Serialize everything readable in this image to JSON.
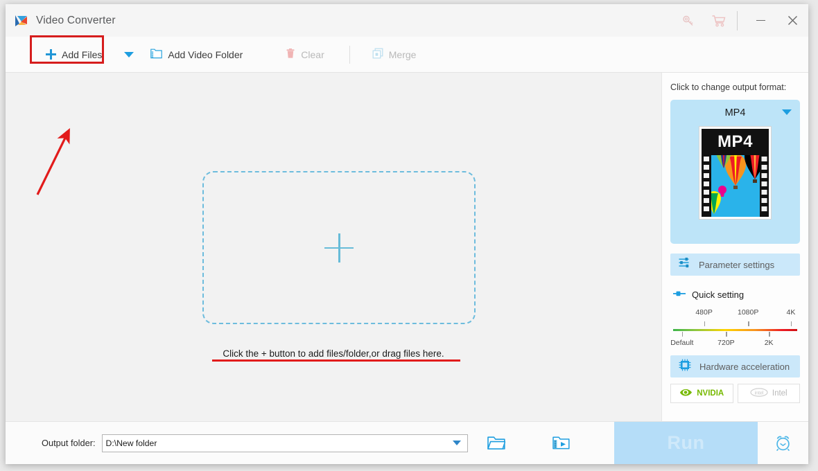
{
  "window": {
    "title": "Video Converter",
    "logo_icon": "app-logo-play-icon",
    "titlebar_icons": [
      "key-icon",
      "shopping-cart-icon"
    ],
    "minimize_label": "–",
    "close_label": "✕"
  },
  "toolbar": {
    "add_files": {
      "label": "Add Files",
      "icon": "plus-icon",
      "highlighted": true
    },
    "dropdown_caret": "chevron-down-icon",
    "add_video_folder": {
      "label": "Add Video Folder",
      "icon": "video-folder-icon"
    },
    "clear": {
      "label": "Clear",
      "icon": "trash-icon",
      "disabled": true
    },
    "merge": {
      "label": "Merge",
      "icon": "merge-squares-icon",
      "disabled": true
    }
  },
  "dropzone": {
    "plus_icon": "large-plus-icon",
    "hint": "Click the + button to add files/folder,or drag files here."
  },
  "annotations": {
    "highlight_color": "#d61d1d",
    "arrow_color": "#e21b1b",
    "underline_color": "#e21b1b"
  },
  "right_panel": {
    "output_format_title": "Click to change output format:",
    "format": {
      "name": "MP4",
      "thumb_label": "MP4",
      "caret_icon": "chevron-down-icon"
    },
    "parameter_settings": {
      "label": "Parameter settings",
      "icon": "sliders-icon"
    },
    "quick_setting": {
      "label": "Quick setting",
      "icon": "slider-handle-icon"
    },
    "quality_slider": {
      "top_labels": [
        "480P",
        "1080P",
        "4K"
      ],
      "bottom_labels": [
        "Default",
        "720P",
        "2K"
      ],
      "gradient": [
        "#3cb54a",
        "#ffd400",
        "#ed1c24"
      ]
    },
    "hardware_acceleration": {
      "label": "Hardware acceleration",
      "icon": "cpu-chip-icon"
    },
    "accelerators": [
      {
        "label": "NVIDIA",
        "icon": "nvidia-eye-icon",
        "enabled": true
      },
      {
        "label": "Intel",
        "icon": "intel-logo-icon",
        "enabled": false
      }
    ]
  },
  "bottom_bar": {
    "output_folder_label": "Output folder:",
    "output_folder_value": "D:\\New folder",
    "output_folder_caret": "chevron-down-icon",
    "open_folder_icon": "open-folder-icon",
    "video_folder_icon": "video-folder-icon",
    "run_button": {
      "label": "Run",
      "disabled": true
    },
    "alarm_icon": "alarm-clock-icon"
  }
}
